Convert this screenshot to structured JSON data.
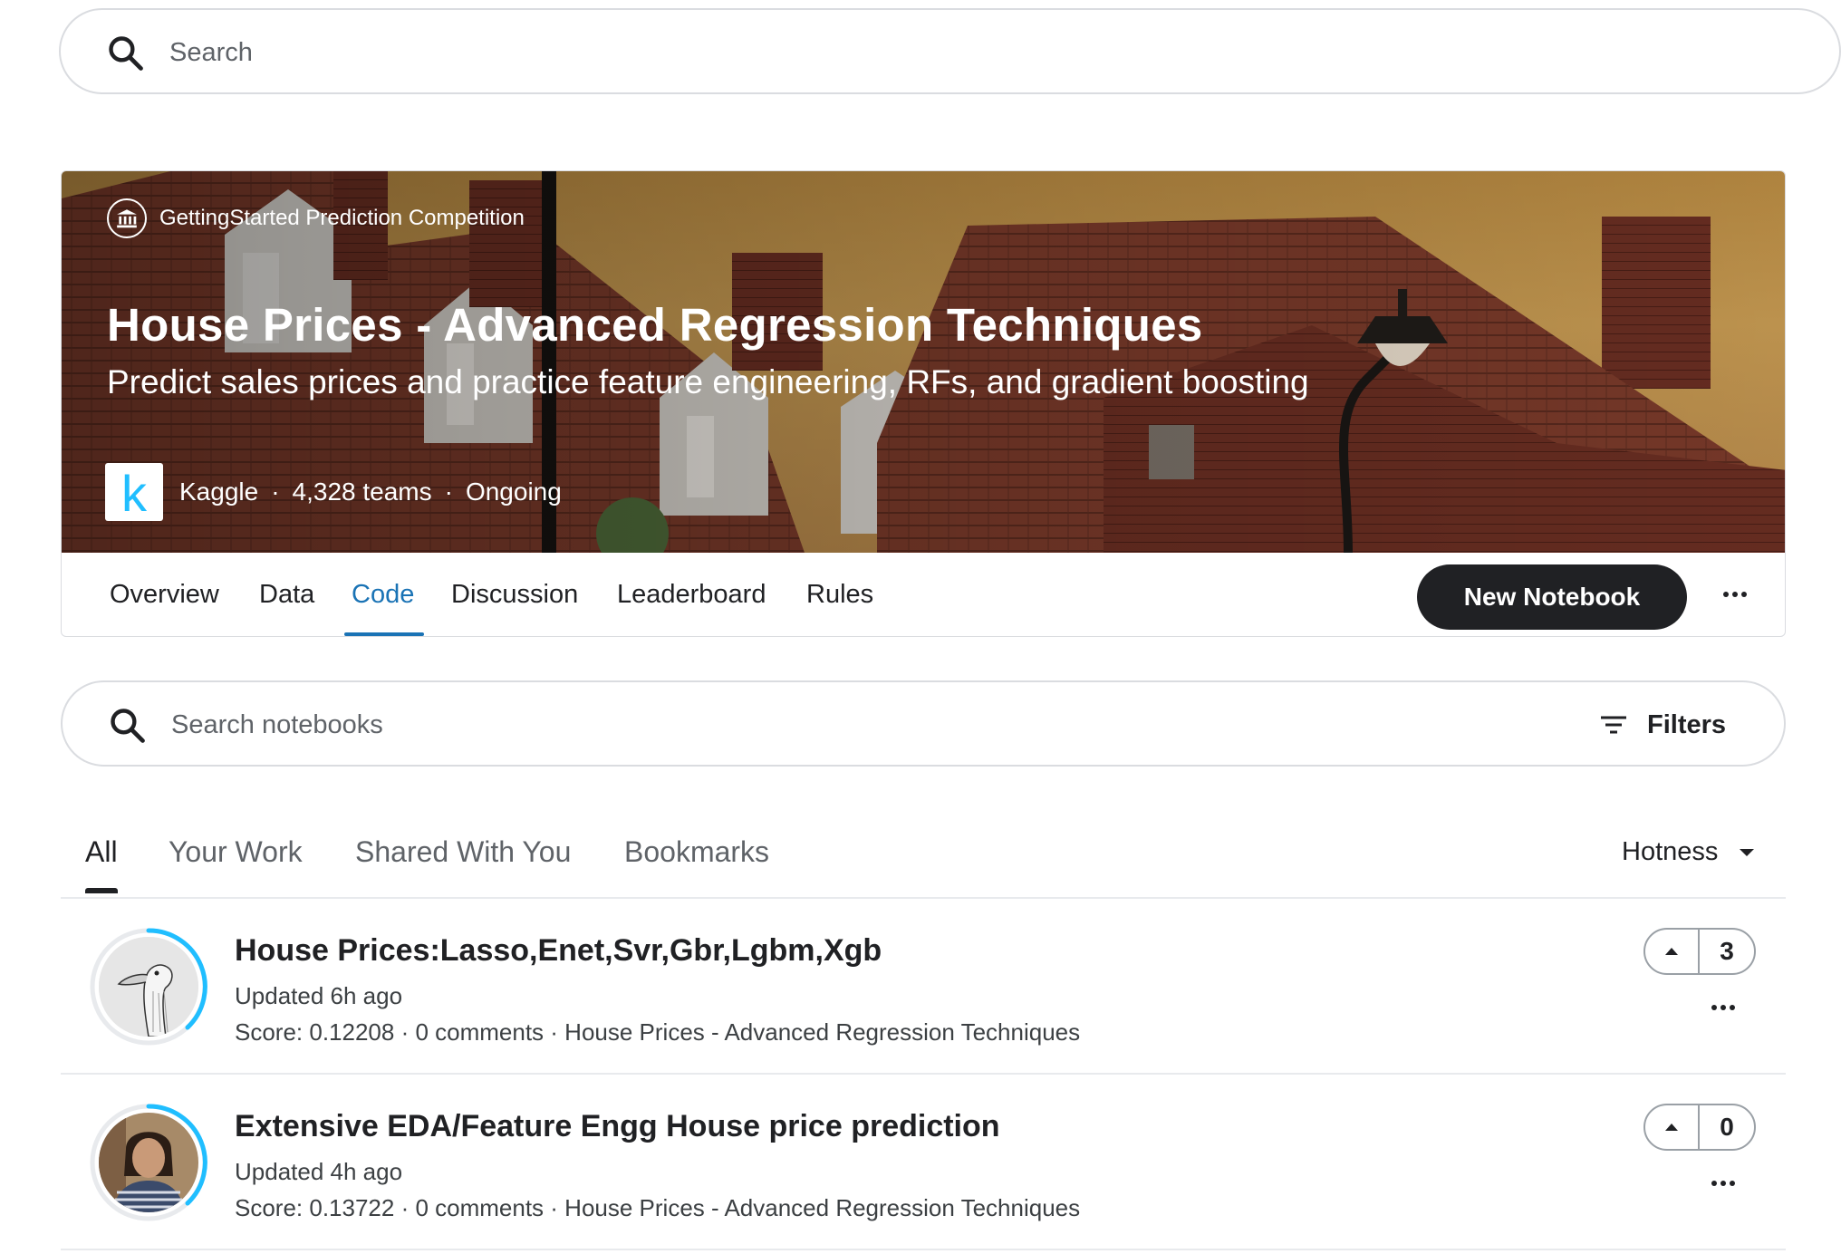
{
  "top_search": {
    "placeholder": "Search"
  },
  "competition": {
    "type_label": "GettingStarted Prediction Competition",
    "title": "House Prices - Advanced Regression Techniques",
    "subtitle": "Predict sales prices and practice feature engineering, RFs, and gradient boosting",
    "host_logo_letter": "k",
    "host": "Kaggle",
    "teams": "4,328 teams",
    "status": "Ongoing",
    "tabs": [
      {
        "label": "Overview"
      },
      {
        "label": "Data"
      },
      {
        "label": "Code",
        "active": true
      },
      {
        "label": "Discussion"
      },
      {
        "label": "Leaderboard"
      },
      {
        "label": "Rules"
      }
    ],
    "new_notebook_label": "New Notebook"
  },
  "notebook_search": {
    "placeholder": "Search notebooks",
    "filters_label": "Filters"
  },
  "sub_tabs": [
    {
      "label": "All",
      "active": true
    },
    {
      "label": "Your Work"
    },
    {
      "label": "Shared With You"
    },
    {
      "label": "Bookmarks"
    }
  ],
  "sort": {
    "label": "Hotness"
  },
  "notebooks": [
    {
      "title": "House Prices:Lasso,Enet,Svr,Gbr,Lgbm,Xgb",
      "updated": "Updated 6h ago",
      "meta": "Score: 0.12208 · 0 comments · House Prices - Advanced Regression Techniques",
      "votes": "3",
      "avatar": "goose-avatar"
    },
    {
      "title": "Extensive EDA/Feature Engg House price prediction",
      "updated": "Updated 4h ago",
      "meta": "Score: 0.13722 · 0 comments · House Prices - Advanced Regression Techniques",
      "votes": "0",
      "avatar": "person-avatar"
    }
  ],
  "colors": {
    "accent": "#1a73b5",
    "dark": "#202124",
    "ring": "#20beff"
  }
}
